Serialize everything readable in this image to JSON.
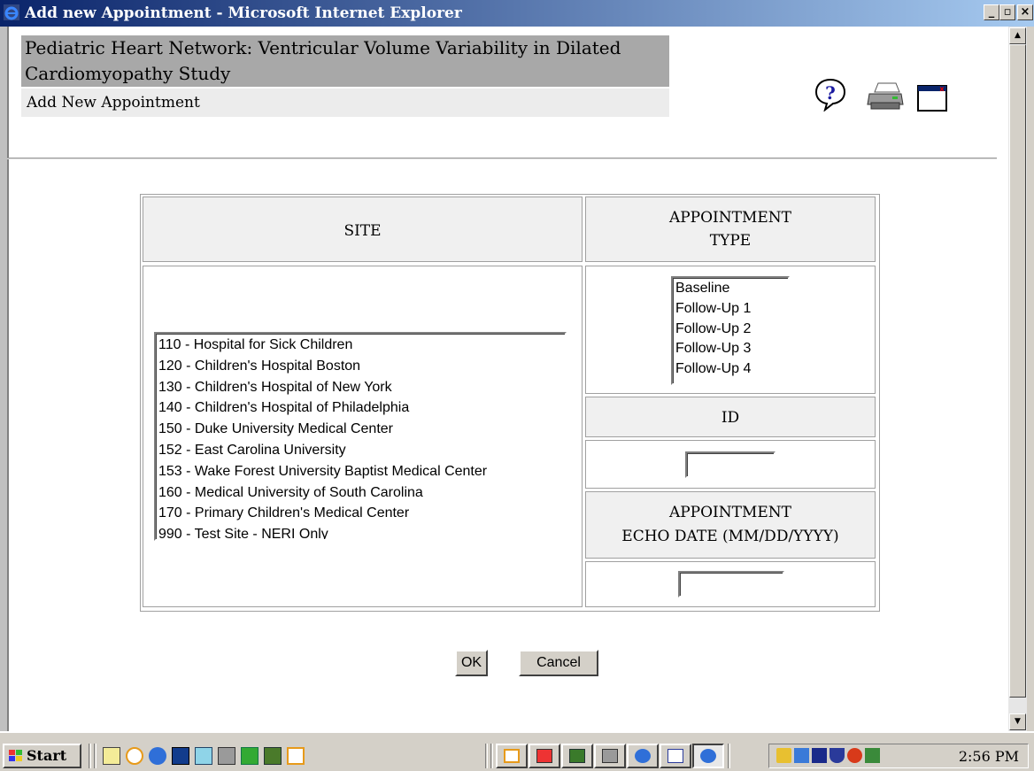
{
  "window": {
    "title": "Add new Appointment - Microsoft Internet Explorer",
    "minimize_label": "_",
    "maximize_label": "▫",
    "close_label": "×"
  },
  "header": {
    "study_title": "Pediatric Heart Network: Ventricular Volume Variability in Dilated Cardiomyopathy Study",
    "page_subtitle": "Add New Appointment",
    "icons": [
      "help-icon",
      "printer-icon",
      "close-window-icon"
    ]
  },
  "form": {
    "site_label": "SITE",
    "appointment_type_label_line1": "APPOINTMENT",
    "appointment_type_label_line2": "TYPE",
    "id_label": "ID",
    "echo_date_label_line1": "APPOINTMENT",
    "echo_date_label_line2": "ECHO DATE (MM/DD/YYYY)",
    "sites": [
      "110 - Hospital for Sick Children",
      "120 - Children's Hospital Boston",
      "130 - Children's Hospital of New York",
      "140 - Children's Hospital of Philadelphia",
      "150 - Duke University Medical Center",
      "152 - East Carolina University",
      "153 - Wake Forest University Baptist Medical Center",
      "160 - Medical University of South Carolina",
      "170 - Primary Children's Medical Center",
      "990 - Test Site - NERI Only"
    ],
    "appointment_types": [
      "Baseline",
      "Follow-Up 1",
      "Follow-Up 2",
      "Follow-Up 3",
      "Follow-Up 4"
    ],
    "id_value": "",
    "echo_date_value": "",
    "ok_label": "OK",
    "cancel_label": "Cancel"
  },
  "taskbar": {
    "start_label": "Start",
    "clock": "2:56 PM"
  },
  "colors": {
    "titlebar_start": "#0a246a",
    "titlebar_end": "#a6caf0",
    "header_band": "#a8a8a8",
    "subheader_band": "#ececec",
    "cell_header": "#f0f0f0",
    "chrome": "#d4d0c8"
  }
}
